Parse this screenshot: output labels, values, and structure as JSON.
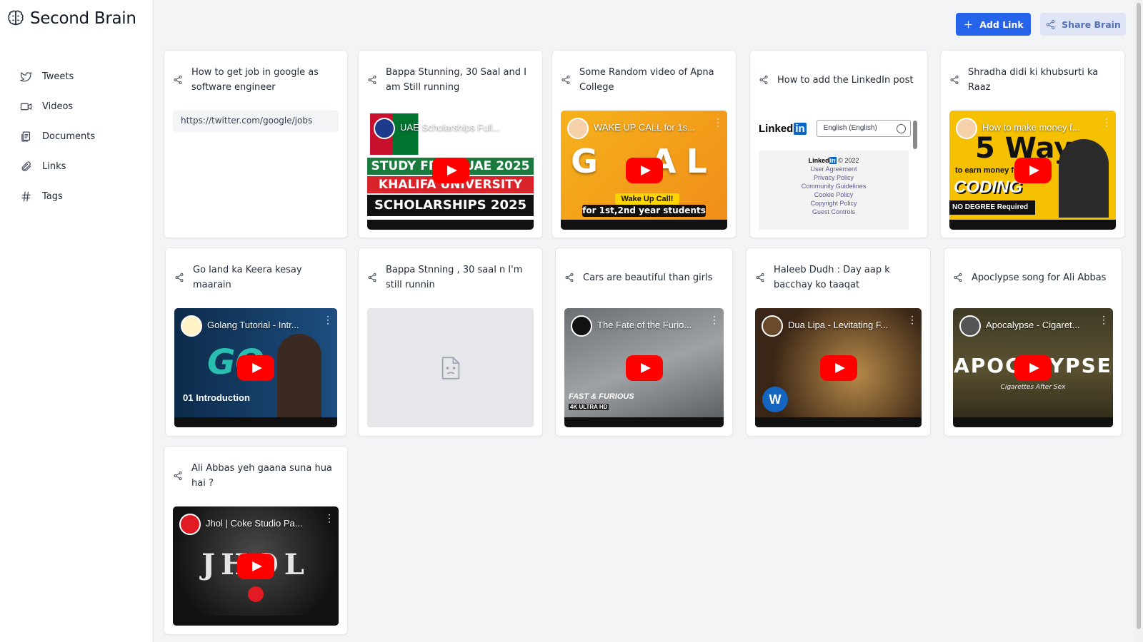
{
  "app": {
    "title": "Second Brain"
  },
  "sidebar": {
    "items": [
      {
        "label": "Tweets",
        "icon": "twitter-icon"
      },
      {
        "label": "Videos",
        "icon": "video-icon"
      },
      {
        "label": "Documents",
        "icon": "document-icon"
      },
      {
        "label": "Links",
        "icon": "paperclip-icon"
      },
      {
        "label": "Tags",
        "icon": "hash-icon"
      }
    ]
  },
  "toolbar": {
    "add_label": "Add Link",
    "share_label": "Share Brain",
    "primary_color": "#2563eb"
  },
  "cards": [
    {
      "title": "How to get job in google as software engineer",
      "type": "link",
      "url": "https://twitter.com/google/jobs"
    },
    {
      "title": "Bappa Stunning, 30 Saal and I am Still running",
      "type": "video",
      "video_title": "UAE Scholarships Full...",
      "overlay": [
        "STUDY FROM UAE 2025",
        "KHALIFA UNIVERSITY",
        "SCHOLARSHIPS 2025"
      ]
    },
    {
      "title": "Some Random video of Apna College",
      "type": "video",
      "video_title": "WAKE UP CALL for 1s...",
      "overlay": [
        "Wake Up Call!",
        "for 1st,2nd year students"
      ]
    },
    {
      "title": "How to add the LinkedIn post",
      "type": "linkedin",
      "li_lang": "English (English)",
      "li_year": "© 2022",
      "li_links": [
        "User Agreement",
        "Privacy Policy",
        "Community Guidelines",
        "Cookie Policy",
        "Copyright Policy",
        "Guest Controls"
      ]
    },
    {
      "title": "Shradha didi ki khubsurti ka Raaz",
      "type": "video",
      "video_title": "How to make money f...",
      "overlay": [
        "5 Ways",
        "to earn money from",
        "CODING",
        "NO DEGREE Required"
      ]
    },
    {
      "title": "Go land ka Keera kesay maarain",
      "type": "video",
      "video_title": "Golang Tutorial - Intr...",
      "overlay": [
        "GO",
        "01 Introduction"
      ]
    },
    {
      "title": "Bappa Stnning , 30 saal n I'm still runnin",
      "type": "placeholder"
    },
    {
      "title": "Cars are beautiful than girls",
      "type": "video",
      "video_title": "The Fate of the Furio...",
      "overlay": [
        "FAST & FURIOUS",
        "4K ULTRA HD"
      ]
    },
    {
      "title": "Haleeb Dudh : Day aap k bacchay ko taaqat",
      "type": "video",
      "video_title": "Dua Lipa - Levitating F..."
    },
    {
      "title": "Apoclypse song for Ali Abbas",
      "type": "video",
      "video_title": "Apocalypse - Cigaret...",
      "overlay": [
        "APOCALYPSE",
        "Cigarettes After Sex"
      ]
    },
    {
      "title": "Ali Abbas yeh gaana suna hua hai ?",
      "type": "video",
      "video_title": "Jhol | Coke Studio Pa...",
      "overlay": [
        "JHOL"
      ]
    }
  ]
}
